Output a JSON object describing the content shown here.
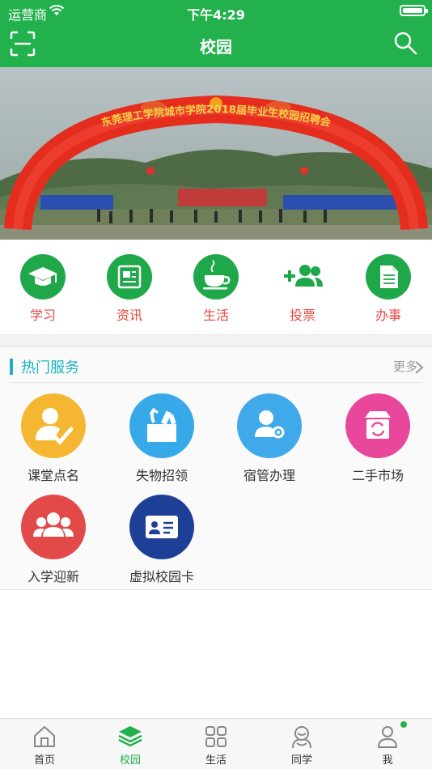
{
  "status_bar": {
    "carrier": "运营商",
    "time": "下午4:29"
  },
  "header": {
    "title": "校园",
    "left_icon": "scan-icon",
    "right_icon": "search-icon",
    "color": "#22b14c"
  },
  "banner": {
    "arch_text": "东莞理工学院城市学院2018届毕业生校园招聘会"
  },
  "quick_actions": [
    {
      "label": "学习",
      "icon": "graduation-cap-icon"
    },
    {
      "label": "资讯",
      "icon": "news-icon"
    },
    {
      "label": "生活",
      "icon": "coffee-cup-icon"
    },
    {
      "label": "投票",
      "icon": "add-users-icon"
    },
    {
      "label": "办事",
      "icon": "document-icon"
    }
  ],
  "hot_services": {
    "title": "热门服务",
    "more": "更多",
    "items": [
      {
        "label": "课堂点名",
        "icon": "attendance-icon",
        "color": "#f5b731"
      },
      {
        "label": "失物招领",
        "icon": "lost-found-icon",
        "color": "#37a9e8"
      },
      {
        "label": "宿管办理",
        "icon": "dorm-admin-icon",
        "color": "#3fa9ea"
      },
      {
        "label": "二手市场",
        "icon": "second-hand-icon",
        "color": "#e8479b"
      },
      {
        "label": "入学迎新",
        "icon": "freshman-icon",
        "color": "#e24a4a"
      },
      {
        "label": "虚拟校园卡",
        "icon": "campus-card-icon",
        "color": "#1d3f96"
      }
    ]
  },
  "tabs": [
    {
      "label": "首页",
      "icon": "home-icon"
    },
    {
      "label": "校园",
      "icon": "layers-icon",
      "active": true
    },
    {
      "label": "生活",
      "icon": "grid-icon"
    },
    {
      "label": "同学",
      "icon": "classmates-icon"
    },
    {
      "label": "我",
      "icon": "profile-icon"
    }
  ]
}
